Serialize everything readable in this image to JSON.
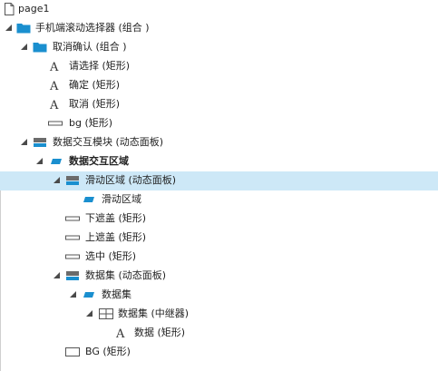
{
  "tree": {
    "items": [
      {
        "label": "page1"
      },
      {
        "label": "手机端滚动选择器 (组合 )"
      },
      {
        "label": "取消确认 (组合 )"
      },
      {
        "label": "请选择 (矩形)"
      },
      {
        "label": "确定 (矩形)"
      },
      {
        "label": "取消 (矩形)"
      },
      {
        "label": "bg (矩形)"
      },
      {
        "label": "数据交互模块 (动态面板)"
      },
      {
        "label": "数据交互区域"
      },
      {
        "label": "滑动区域 (动态面板)"
      },
      {
        "label": "滑动区域"
      },
      {
        "label": "下遮盖 (矩形)"
      },
      {
        "label": "上遮盖 (矩形)"
      },
      {
        "label": "选中 (矩形)"
      },
      {
        "label": "数据集 (动态面板)"
      },
      {
        "label": "数据集"
      },
      {
        "label": "数据集 (中继器)"
      },
      {
        "label": "数据 (矩形)"
      },
      {
        "label": "BG (矩形)"
      }
    ]
  },
  "colors": {
    "accent": "#1a8fcf",
    "selection": "#cde8f7",
    "panel_icon": "#6b6b6b"
  }
}
